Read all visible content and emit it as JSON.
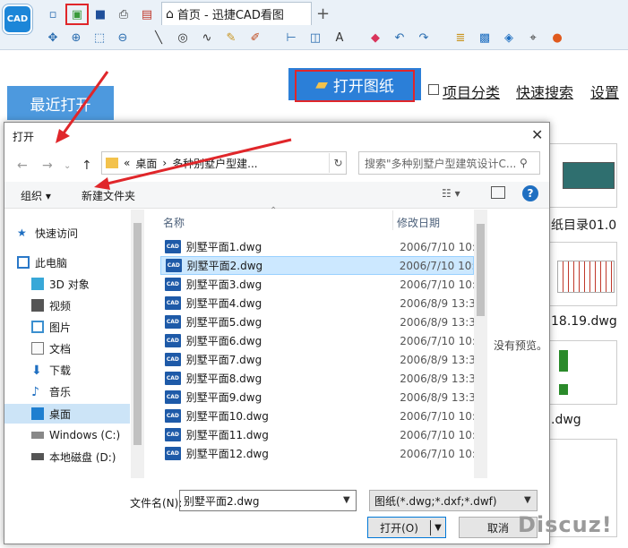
{
  "app": {
    "logo": "CAD",
    "tab_title": "首页 - 迅捷CAD看图",
    "tab_plus": "+"
  },
  "actions": {
    "open_drawing": "打开图纸",
    "project_category": "项目分类",
    "quick_search": "快速搜索",
    "settings": "设置",
    "recent_open": "最近打开"
  },
  "thumbs": [
    "纸目录01.0",
    "18.19.dwg",
    ".dwg"
  ],
  "dialog": {
    "title": "打开",
    "close": "✕",
    "address": {
      "prefix": "«",
      "crumb1": "桌面",
      "sep": "›",
      "crumb2": "多种别墅户型建...",
      "refresh": "↻"
    },
    "search_placeholder": "搜索\"多种别墅户型建筑设计C...",
    "organize": "组织 ▾",
    "new_folder": "新建文件夹",
    "help": "?",
    "nav": [
      {
        "label": "快速访问",
        "icon": "star-icon"
      },
      {
        "label": "此电脑",
        "icon": "computer-icon"
      },
      {
        "label": "3D 对象",
        "icon": "cube-icon"
      },
      {
        "label": "视频",
        "icon": "video-icon"
      },
      {
        "label": "图片",
        "icon": "picture-icon"
      },
      {
        "label": "文档",
        "icon": "document-icon"
      },
      {
        "label": "下载",
        "icon": "download-icon"
      },
      {
        "label": "音乐",
        "icon": "music-icon"
      },
      {
        "label": "桌面",
        "icon": "desktop-icon"
      },
      {
        "label": "Windows (C:)",
        "icon": "drive-icon"
      },
      {
        "label": "本地磁盘 (D:)",
        "icon": "drive-icon"
      }
    ],
    "columns": {
      "name": "名称",
      "date": "修改日期"
    },
    "files": [
      {
        "name": "别墅平面1.dwg",
        "date": "2006/7/10 10:0"
      },
      {
        "name": "别墅平面2.dwg",
        "date": "2006/7/10 10:0"
      },
      {
        "name": "别墅平面3.dwg",
        "date": "2006/7/10 10:0"
      },
      {
        "name": "别墅平面4.dwg",
        "date": "2006/8/9 13:3"
      },
      {
        "name": "别墅平面5.dwg",
        "date": "2006/8/9 13:3"
      },
      {
        "name": "别墅平面6.dwg",
        "date": "2006/7/10 10:0"
      },
      {
        "name": "别墅平面7.dwg",
        "date": "2006/8/9 13:3"
      },
      {
        "name": "别墅平面8.dwg",
        "date": "2006/8/9 13:3"
      },
      {
        "name": "别墅平面9.dwg",
        "date": "2006/8/9 13:3"
      },
      {
        "name": "别墅平面10.dwg",
        "date": "2006/7/10 10:0"
      },
      {
        "name": "别墅平面11.dwg",
        "date": "2006/7/10 10:0"
      },
      {
        "name": "别墅平面12.dwg",
        "date": "2006/7/10 10:0"
      }
    ],
    "file_icon_text": "CAD",
    "no_preview": "没有预览。",
    "filename_label": "文件名(N):",
    "filename_value": "别墅平面2.dwg",
    "filetype": "图纸(*.dwg;*.dxf;*.dwf)",
    "open_button": "打开(O)",
    "cancel_button": "取消"
  },
  "watermark": "Discuz!"
}
